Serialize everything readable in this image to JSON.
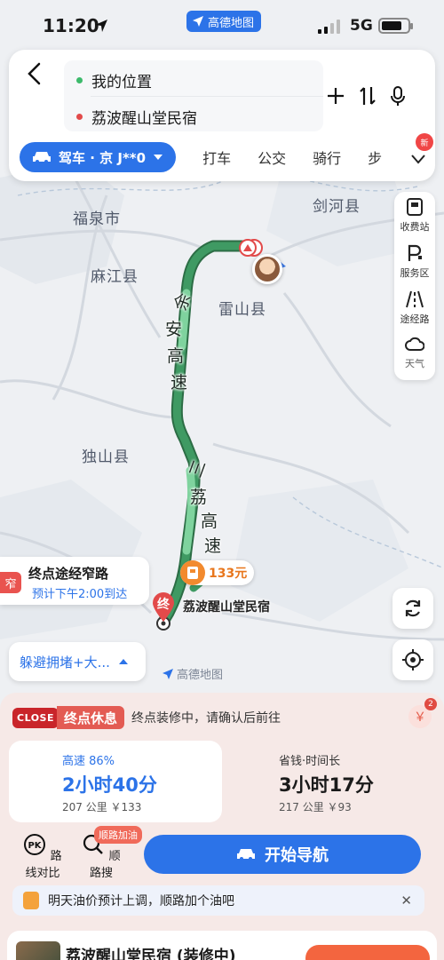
{
  "status_bar": {
    "time": "11:20",
    "network": "5G",
    "battery_percent": 80
  },
  "app_badge": "高德地图",
  "route_card": {
    "origin": "我的位置",
    "destination": "荔波醒山堂民宿",
    "modes": {
      "active": "驾车 · 京 J**0",
      "others": [
        "打车",
        "公交",
        "骑行",
        "步"
      ]
    },
    "new_badge": "新"
  },
  "map": {
    "places": [
      "福泉市",
      "剑河县",
      "麻江县",
      "雷山县",
      "独山县"
    ],
    "road1_chars": [
      "余",
      "安",
      "高",
      "速"
    ],
    "road2_chars": [
      "三",
      "荔",
      "高",
      "速"
    ],
    "toll_price": "133元",
    "end_tag": "终",
    "dest_label": "荔波醒山堂民宿",
    "watermark": "高德地图"
  },
  "tools": [
    "收费站",
    "服务区",
    "途经路",
    "天气"
  ],
  "narrow_hint": {
    "tag": "窄",
    "title": "终点途经窄路",
    "eta": "预计下午2:00到达"
  },
  "avoid_button": "躲避拥堵+大...",
  "sheet": {
    "close_badge": "CLOSE",
    "warn_tag": "终点休息",
    "warn_text": "终点装修中，请确认后前往",
    "yen_count": "2",
    "option_a": {
      "tag": "高速 86%",
      "time": "2小时40分",
      "meta": "207 公里  ￥133"
    },
    "option_b": {
      "tag": "省钱·时间长",
      "time": "3小时17分",
      "meta": "217 公里  ￥93"
    },
    "compare_label": "路线对比",
    "along_label": "顺路搜",
    "refuel_tag": "顺路加油",
    "start_label": "开始导航",
    "tip": "明天油价预计上调，顺路加个油吧",
    "next_title": "荔波醒山堂民宿 (装修中)"
  }
}
